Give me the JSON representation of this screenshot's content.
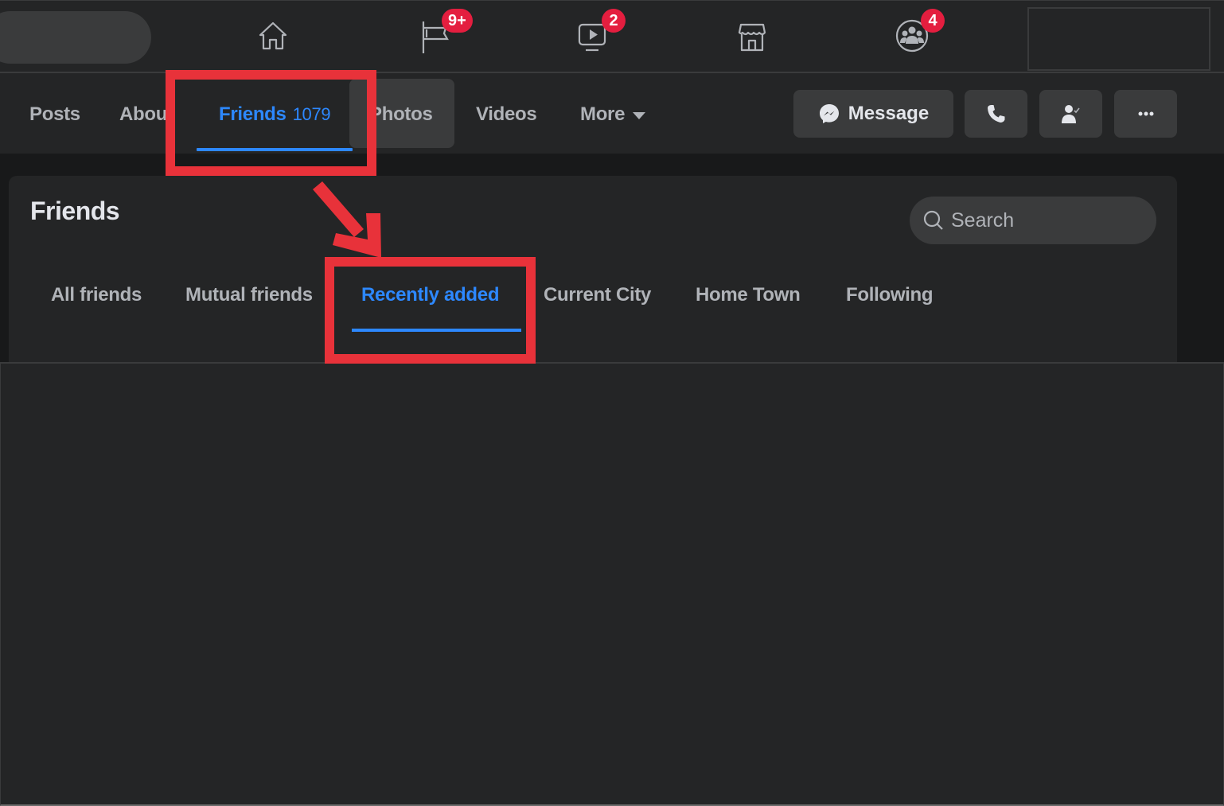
{
  "topnav": {
    "icons": [
      {
        "name": "home-icon",
        "badge": null
      },
      {
        "name": "pages-flag-icon",
        "badge": "9+"
      },
      {
        "name": "watch-video-icon",
        "badge": "2"
      },
      {
        "name": "marketplace-icon",
        "badge": null
      },
      {
        "name": "groups-icon",
        "badge": "4"
      }
    ],
    "badges": {
      "pages": "9+",
      "watch": "2",
      "groups": "4"
    }
  },
  "profile_tabs": {
    "posts": "Posts",
    "about": "About",
    "friends": "Friends",
    "friends_count": "1079",
    "photos": "Photos",
    "videos": "Videos",
    "more": "More",
    "active": "Friends"
  },
  "actions": {
    "message": "Message",
    "call_icon": "phone-icon",
    "friends_icon": "friends-check-icon",
    "more_icon": "more-dots-icon"
  },
  "friends_section": {
    "title": "Friends",
    "search_placeholder": "Search",
    "tabs": [
      "All friends",
      "Mutual friends",
      "Recently added",
      "Current City",
      "Home Town",
      "Following"
    ],
    "active_tab": "Recently added"
  },
  "colors": {
    "accent": "#2d88ff",
    "badge": "#e41e3f",
    "annotation": "#e8323a",
    "background": "#242526",
    "surface": "#3a3b3c"
  }
}
